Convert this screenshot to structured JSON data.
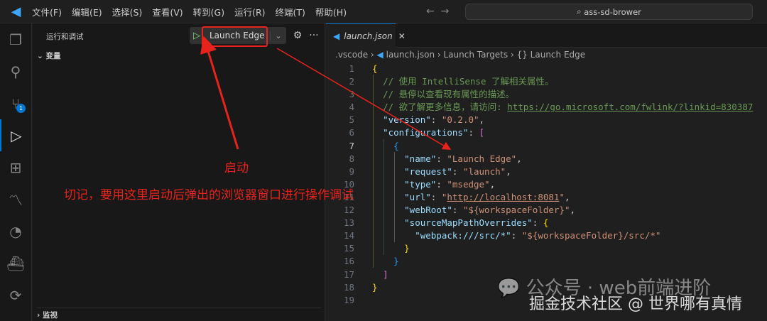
{
  "menu": [
    "文件(F)",
    "编辑(E)",
    "选择(S)",
    "查看(V)",
    "转到(G)",
    "运行(R)",
    "终端(T)",
    "帮助(H)"
  ],
  "search_text": "ass-sd-brower",
  "activity_badge": "1",
  "sidebar": {
    "title": "运行和调试",
    "launch_config": "Launch Edge",
    "variables": "变量",
    "watch": "监视"
  },
  "editor": {
    "tab": "launch.json",
    "breadcrumb": [
      ".vscode",
      "launch.json",
      "Launch Targets",
      "{} Launch Edge"
    ],
    "current_line": 7,
    "lines": [
      [
        [
          "b1",
          "{"
        ]
      ],
      [
        [
          "p",
          "  "
        ],
        [
          "c",
          "// 使用 IntelliSense 了解相关属性。"
        ]
      ],
      [
        [
          "p",
          "  "
        ],
        [
          "c",
          "// 悬停以查看现有属性的描述。"
        ]
      ],
      [
        [
          "p",
          "  "
        ],
        [
          "c",
          "// 欲了解更多信息，请访问: "
        ],
        [
          "cu",
          "https://go.microsoft.com/fwlink/?linkid=830387"
        ]
      ],
      [
        [
          "p",
          "  "
        ],
        [
          "k",
          "\"version\""
        ],
        [
          "p",
          ": "
        ],
        [
          "s",
          "\"0.2.0\""
        ],
        [
          "p",
          ","
        ]
      ],
      [
        [
          "p",
          "  "
        ],
        [
          "k",
          "\"configurations\""
        ],
        [
          "p",
          ": "
        ],
        [
          "b2",
          "["
        ]
      ],
      [
        [
          "p",
          "    "
        ],
        [
          "b3",
          "{"
        ]
      ],
      [
        [
          "p",
          "      "
        ],
        [
          "k",
          "\"name\""
        ],
        [
          "p",
          ": "
        ],
        [
          "s",
          "\"Launch Edge\""
        ],
        [
          "p",
          ","
        ]
      ],
      [
        [
          "p",
          "      "
        ],
        [
          "k",
          "\"request\""
        ],
        [
          "p",
          ": "
        ],
        [
          "s",
          "\"launch\""
        ],
        [
          "p",
          ","
        ]
      ],
      [
        [
          "p",
          "      "
        ],
        [
          "k",
          "\"type\""
        ],
        [
          "p",
          ": "
        ],
        [
          "s",
          "\"msedge\""
        ],
        [
          "p",
          ","
        ]
      ],
      [
        [
          "p",
          "      "
        ],
        [
          "k",
          "\"url\""
        ],
        [
          "p",
          ": "
        ],
        [
          "s",
          "\""
        ],
        [
          "u",
          "http://localhost:8081"
        ],
        [
          "s",
          "\""
        ],
        [
          "p",
          ","
        ]
      ],
      [
        [
          "p",
          "      "
        ],
        [
          "k",
          "\"webRoot\""
        ],
        [
          "p",
          ": "
        ],
        [
          "s",
          "\"${workspaceFolder}\""
        ],
        [
          "p",
          ","
        ]
      ],
      [
        [
          "p",
          "      "
        ],
        [
          "k",
          "\"sourceMapPathOverrides\""
        ],
        [
          "p",
          ": "
        ],
        [
          "b1",
          "{"
        ]
      ],
      [
        [
          "p",
          "        "
        ],
        [
          "k",
          "\"webpack:///src/*\""
        ],
        [
          "p",
          ": "
        ],
        [
          "s",
          "\"${workspaceFolder}/src/*\""
        ]
      ],
      [
        [
          "p",
          "      "
        ],
        [
          "b1",
          "}"
        ]
      ],
      [
        [
          "p",
          "    "
        ],
        [
          "b3",
          "}"
        ]
      ],
      [
        [
          "p",
          "  "
        ],
        [
          "b2",
          "]"
        ]
      ],
      [
        [
          "b1",
          "}"
        ]
      ],
      []
    ]
  },
  "annotations": {
    "start": "启动",
    "reminder": "切记，要用这里启动后弹出的浏览器窗口进行操作调试"
  },
  "watermark": {
    "line1": "公众号 · web前端进阶",
    "line2": "掘金技术社区 @ 世界哪有真情"
  }
}
